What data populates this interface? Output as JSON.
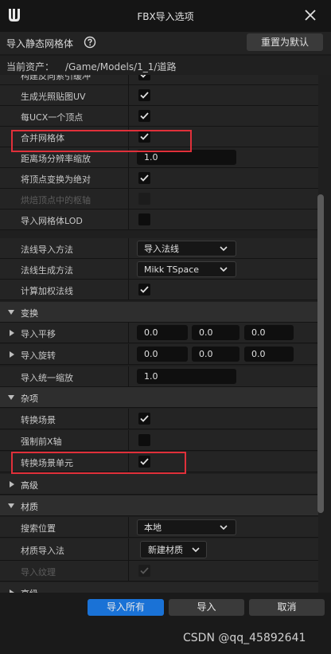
{
  "window": {
    "title": "FBX导入选项"
  },
  "header": {
    "label": "导入静态网格体",
    "reset_button": "重置为默认"
  },
  "asset": {
    "label": "当前资产：",
    "path": "/Game/Models/1_1/道路"
  },
  "rows": {
    "r0": {
      "label": "构建反向索引缓冲",
      "checked": true
    },
    "r1": {
      "label": "生成光照贴图UV",
      "checked": true
    },
    "r2": {
      "label": "每UCX一个顶点",
      "checked": true
    },
    "r3": {
      "label": "合并网格体",
      "checked": true
    },
    "r4": {
      "label": "距离场分辨率缩放",
      "value": "1.0"
    },
    "r5": {
      "label": "将顶点变换为绝对",
      "checked": true
    },
    "r6": {
      "label": "烘焙顶点中的枢轴",
      "checked": false,
      "disabled": true
    },
    "r7": {
      "label": "导入网格体LOD",
      "checked": false
    },
    "r8": {
      "label": "法线导入方法",
      "value": "导入法线"
    },
    "r9": {
      "label": "法线生成方法",
      "value": "Mikk TSpace"
    },
    "r10": {
      "label": "计算加权法线",
      "checked": true
    },
    "cat_transform": {
      "label": "变换"
    },
    "r11": {
      "label": "导入平移",
      "x": "0.0",
      "y": "0.0",
      "z": "0.0"
    },
    "r12": {
      "label": "导入旋转",
      "x": "0.0",
      "y": "0.0",
      "z": "0.0"
    },
    "r13": {
      "label": "导入统一缩放",
      "value": "1.0"
    },
    "cat_misc": {
      "label": "杂项"
    },
    "r14": {
      "label": "转换场景",
      "checked": true
    },
    "r15": {
      "label": "强制前X轴",
      "checked": false
    },
    "r16": {
      "label": "转换场景单元",
      "checked": true
    },
    "cat_advanced": {
      "label": "高级"
    },
    "cat_material": {
      "label": "材质"
    },
    "r17": {
      "label": "搜索位置",
      "value": "本地"
    },
    "r18": {
      "label": "材质导入法",
      "value": "新建材质"
    },
    "r19": {
      "label": "导入纹理",
      "checked": true,
      "disabled": true
    },
    "cat_advanced2": {
      "label": "高级"
    }
  },
  "footer": {
    "import_all": "导入所有",
    "import": "导入",
    "cancel": "取消",
    "watermark": "CSDN @qq_45892641"
  },
  "colors": {
    "accent": "#1a72d6",
    "highlight": "#e0303a"
  }
}
